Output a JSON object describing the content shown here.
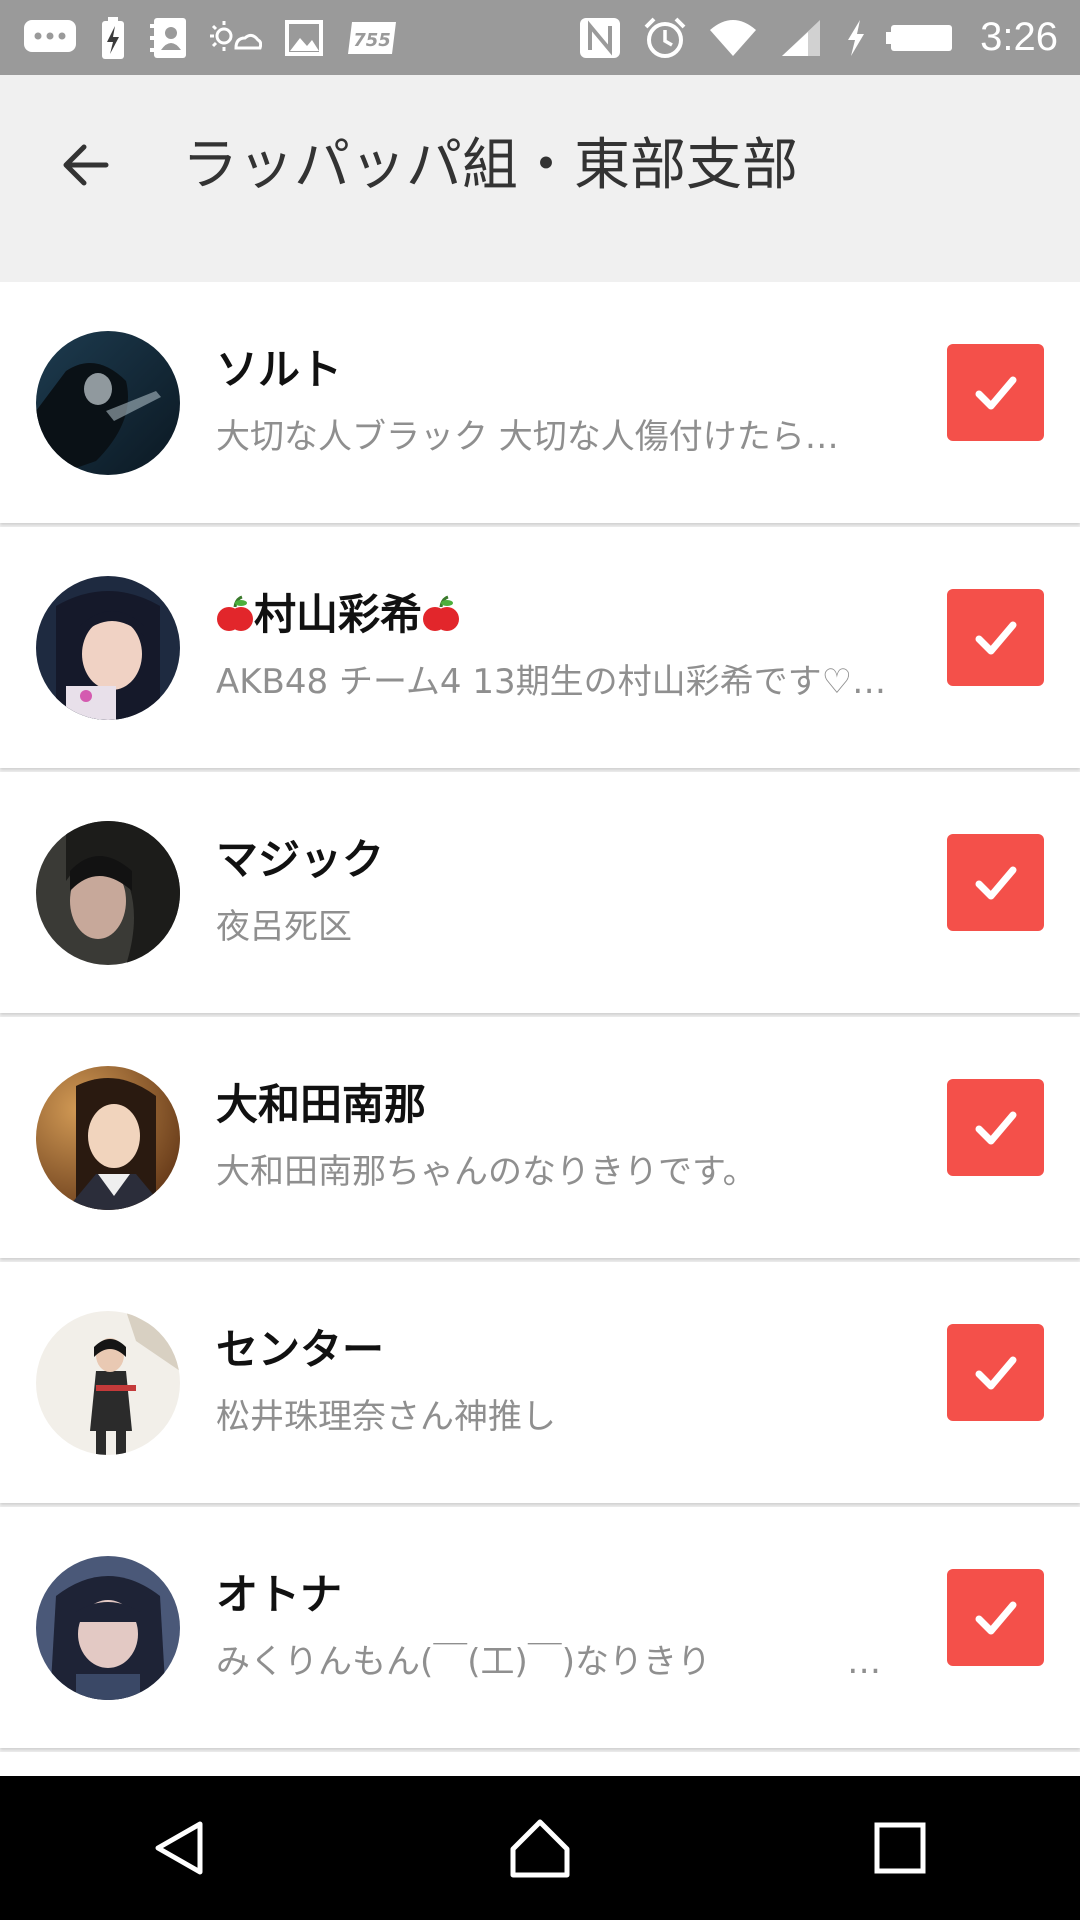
{
  "status_bar": {
    "time": "3:26",
    "left_icons": [
      "chat-bubble-icon",
      "battery-charging-icon",
      "contacts-icon",
      "weather-icon",
      "image-icon",
      "755-app-icon"
    ],
    "right_icons": [
      "nfc-icon",
      "alarm-icon",
      "wifi-icon",
      "signal-icon",
      "charging-bolt-icon",
      "battery-icon"
    ],
    "background": "#9a9a9a"
  },
  "app_bar": {
    "title": "ラッパッパ組・東部支部",
    "back_icon": "arrow-back-icon"
  },
  "members": [
    {
      "name": "ソルト",
      "description": "大切な人ブラック 大切な人傷付けたら…",
      "checked": true,
      "avatar": "avatar-1"
    },
    {
      "name": "村山彩希",
      "name_prefix_icon": "apple-icon",
      "name_suffix_icon": "apple-icon",
      "description": "AKB48 チーム4 13期生の村山彩希です♡…",
      "checked": true,
      "avatar": "avatar-2"
    },
    {
      "name": "マジック",
      "description": "夜呂死区",
      "checked": true,
      "avatar": "avatar-3"
    },
    {
      "name": "大和田南那",
      "description": "大和田南那ちゃんのなりきりです。",
      "checked": true,
      "avatar": "avatar-4"
    },
    {
      "name": "センター",
      "description": "松井珠理奈さん神推し",
      "checked": true,
      "avatar": "avatar-5"
    },
    {
      "name": "オトナ",
      "description": "みくりんもん(￣(工)￣)なりきり　　　　　…",
      "checked": true,
      "avatar": "avatar-6"
    }
  ],
  "colors": {
    "accent": "#f4504a",
    "appbar_background": "#f0f0f0",
    "navbar_background": "#000000"
  },
  "nav_bar": {
    "icons": [
      "nav-back-icon",
      "nav-home-icon",
      "nav-recents-icon"
    ]
  }
}
